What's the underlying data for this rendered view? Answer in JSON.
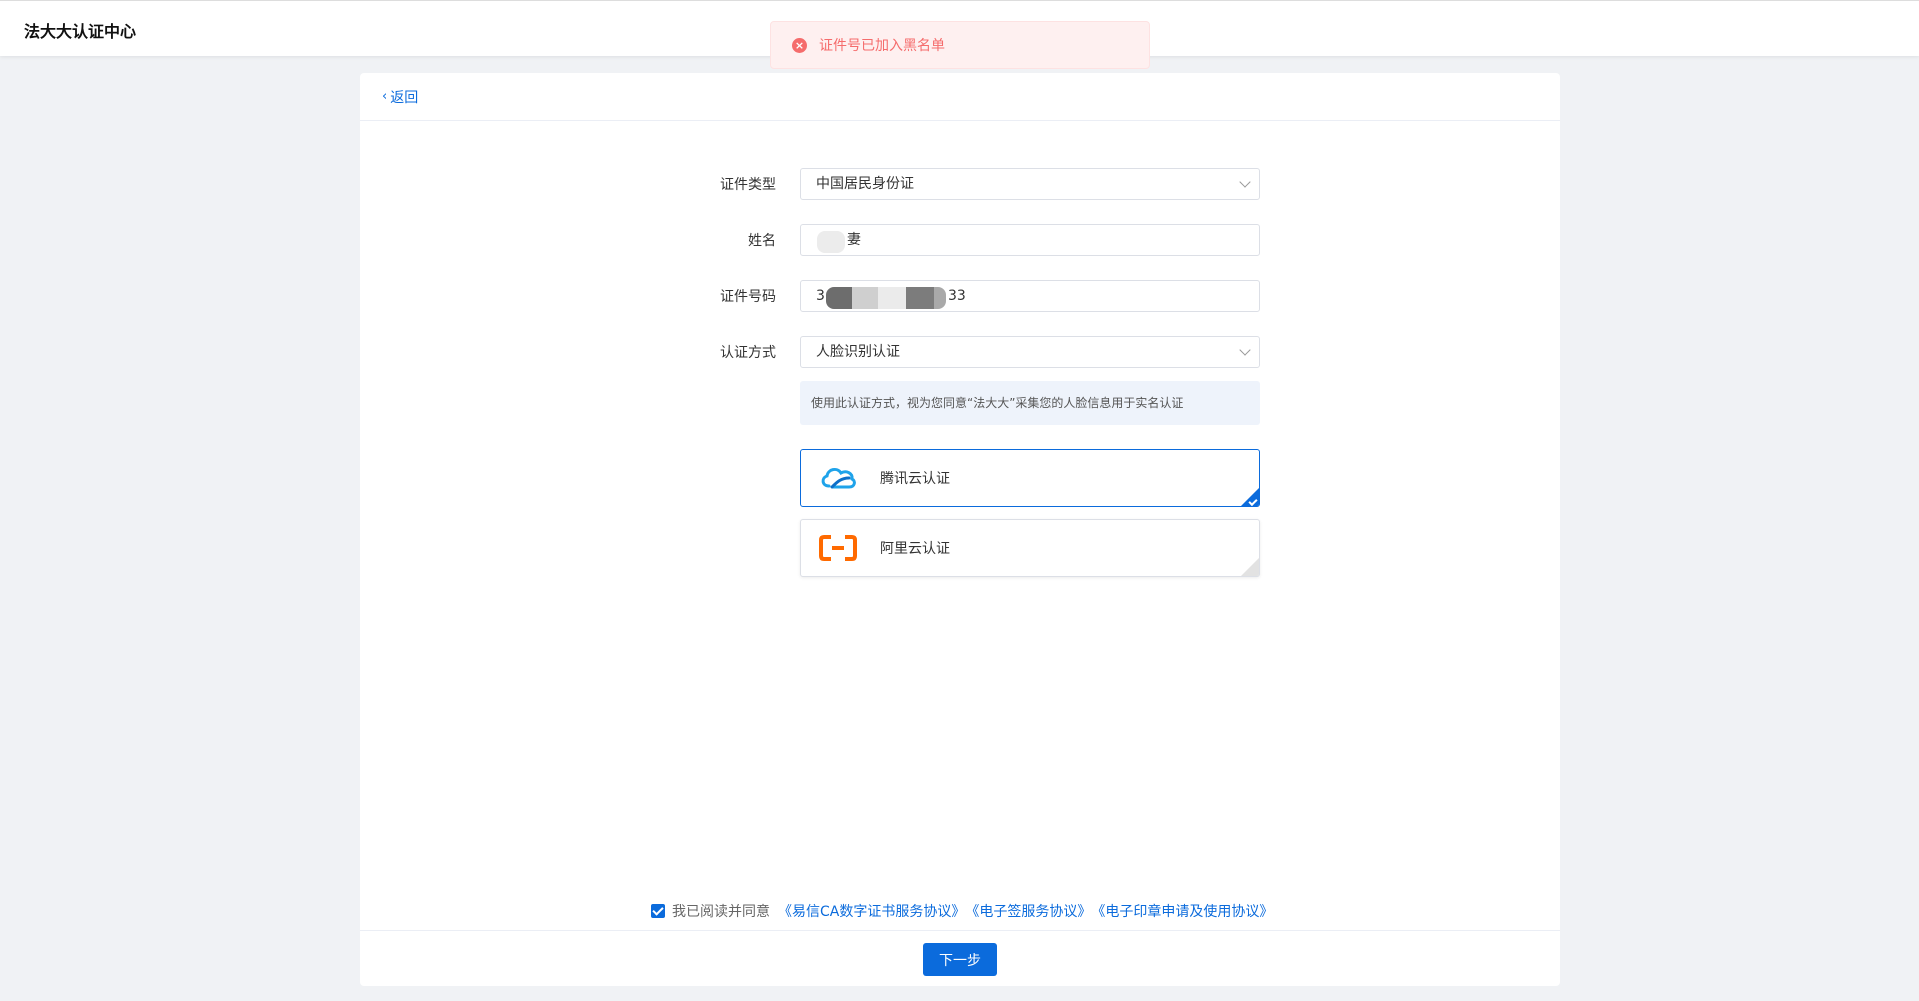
{
  "header": {
    "title": "法大大认证中心"
  },
  "toast": {
    "message": "证件号已加入黑名单",
    "type": "error"
  },
  "nav": {
    "back_label": "返回"
  },
  "form": {
    "id_type": {
      "label": "证件类型",
      "value": "中国居民身份证"
    },
    "name": {
      "label": "姓名",
      "value_visible_suffix": "妻",
      "redacted": true
    },
    "id_number": {
      "label": "证件号码",
      "value_visible_prefix": "3",
      "value_visible_suffix": "33",
      "redacted": true
    },
    "auth_method": {
      "label": "认证方式",
      "value": "人脸识别认证"
    },
    "hint": "使用此认证方式，视为您同意“法大大”采集您的人脸信息用于实名认证"
  },
  "providers": [
    {
      "label": "腾讯云认证",
      "icon": "tencent-cloud-icon",
      "selected": true
    },
    {
      "label": "阿里云认证",
      "icon": "aliyun-icon",
      "selected": false
    }
  ],
  "agreement": {
    "checked": true,
    "prefix": "我已阅读并同意",
    "links": [
      "《易信CA数字证书服务协议》",
      "《电子签服务协议》",
      "《电子印章申请及使用协议》"
    ]
  },
  "footer": {
    "next_label": "下一步"
  },
  "colors": {
    "primary": "#0b6bdc",
    "error": "#f56c6c",
    "aliyun": "#ff6a00",
    "tencent": "#1fa3ea"
  }
}
